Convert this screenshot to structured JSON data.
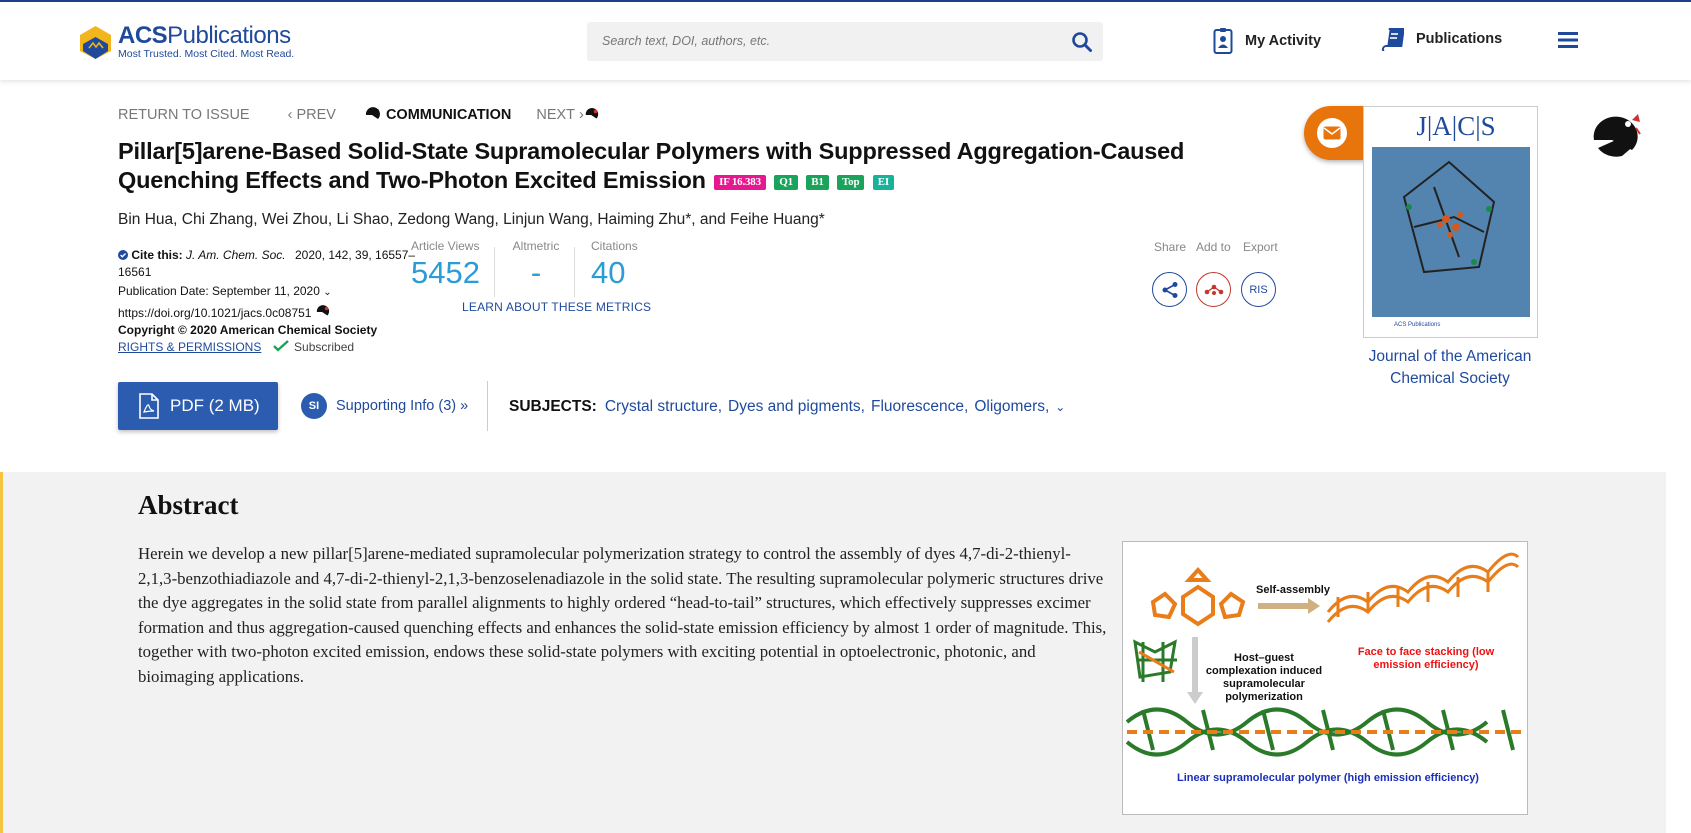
{
  "header": {
    "logo_name_a": "ACS",
    "logo_name_b": "Publications",
    "logo_tagline": "Most Trusted. Most Cited. Most Read.",
    "search_placeholder": "Search text, DOI, authors, etc.",
    "my_activity": "My Activity",
    "publications": "Publications"
  },
  "breadcrumbs": {
    "return": "RETURN TO ISSUE",
    "prev": "PREV",
    "type": "COMMUNICATION",
    "next": "NEXT"
  },
  "article": {
    "title": "Pillar[5]arene-Based Solid-State Supramolecular Polymers with Suppressed Aggregation-Caused Quenching Effects and Two-Photon Excited Emission",
    "badges": [
      {
        "text": "IF 16.383",
        "color": "#e6178f"
      },
      {
        "text": "Q1",
        "color": "#1aa35a"
      },
      {
        "text": "B1",
        "color": "#1aa35a"
      },
      {
        "text": "Top",
        "color": "#1aa35a"
      },
      {
        "text": "EI",
        "color": "#14b39a"
      }
    ],
    "authors": "Bin Hua, Chi Zhang, Wei Zhou, Li Shao, Zedong Wang, Linjun Wang, Haiming Zhu*, and Feihe Huang*",
    "cite_label": "Cite this:",
    "cite_journal": "J. Am. Chem. Soc.",
    "cite_ref": "2020, 142, 39, 16557–16561",
    "pub_date": "Publication Date: September 11, 2020",
    "doi": "https://doi.org/10.1021/jacs.0c08751",
    "copyright": "Copyright © 2020 American Chemical Society",
    "rights": "RIGHTS & PERMISSIONS",
    "subscribed": "Subscribed"
  },
  "metrics": {
    "views_label": "Article Views",
    "views_value": "5452",
    "altmetric_label": "Altmetric",
    "altmetric_value": "-",
    "citations_label": "Citations",
    "citations_value": "40",
    "learn": "LEARN ABOUT THESE METRICS"
  },
  "actions": {
    "share": "Share",
    "add_to": "Add to",
    "export": "Export",
    "ris": "RIS"
  },
  "downloads": {
    "pdf": "PDF (2 MB)",
    "si_badge": "SI",
    "supporting": "Supporting Info (3) »"
  },
  "subjects": {
    "label": "SUBJECTS:",
    "items": [
      "Crystal structure,",
      "Dyes and pigments,",
      "Fluorescence,",
      "Oligomers,"
    ]
  },
  "journal": {
    "cover_title": "J|A|C|S",
    "name": "Journal of the American Chemical Society"
  },
  "abstract": {
    "heading": "Abstract",
    "text": "Herein we develop a new pillar[5]arene-mediated supramolecular polymerization strategy to control the assembly of dyes 4,7-di-2-thienyl-2,1,3-benzothiadiazole and 4,7-di-2-thienyl-2,1,3-benzoselenadiazole in the solid state. The resulting supramolecular polymeric structures drive the dye aggregates in the solid state from parallel alignments to highly ordered “head-to-tail” structures, which effectively suppresses excimer formation and thus aggregation-caused quenching effects and enhances the solid-state emission efficiency by almost 1 order of magnitude. This, together with two-photon excited emission, endows these solid-state polymers with exciting potential in optoelectronic, photonic, and bioimaging applications.",
    "toc_self": "Self-assembly",
    "toc_host": "Host–guest complexation induced supramolecular polymerization",
    "toc_face": "Face to face stacking (low emission efficiency)",
    "toc_linear": "Linear supramolecular polymer (high emission efficiency)"
  },
  "colors": {
    "brand_blue": "#1f4a9c",
    "metric_blue": "#2b9cd6",
    "accent_orange": "#e8740c",
    "abstract_bg": "#f2f2f2"
  }
}
